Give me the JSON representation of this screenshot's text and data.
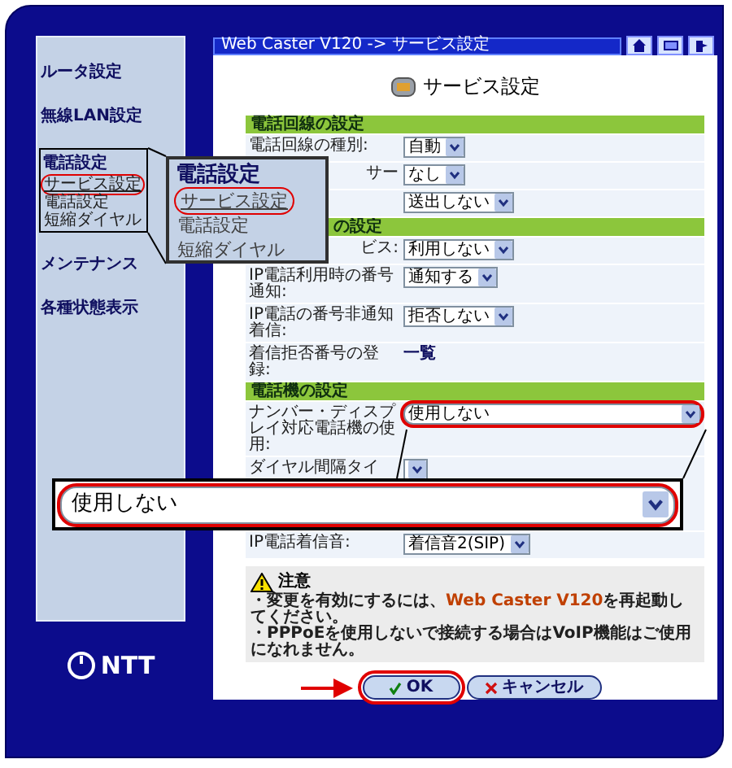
{
  "window": {
    "title": "Web Caster V120 -> サービス設定"
  },
  "sidebar": {
    "items": [
      {
        "label": "ルータ設定"
      },
      {
        "label": "無線LAN設定"
      },
      {
        "label": "電話設定",
        "children": [
          {
            "label": "サービス設定",
            "selected": true
          },
          {
            "label": "電話設定",
            "selected": false
          },
          {
            "label": "短縮ダイヤル",
            "selected": false
          }
        ]
      },
      {
        "label": "メンテナンス"
      },
      {
        "label": "各種状態表示"
      }
    ]
  },
  "sidebar_zoom": {
    "title": "電話設定",
    "items": [
      {
        "label": "サービス設定",
        "selected": true
      },
      {
        "label": "電話設定",
        "selected": false
      },
      {
        "label": "短縮ダイヤル",
        "selected": false
      }
    ]
  },
  "logo": "NTT",
  "page_title": "サービス設定",
  "sections": [
    {
      "title": "電話回線の設定",
      "rows": [
        {
          "label": "電話回線の種別:",
          "kind": "select",
          "value": "自動"
        },
        {
          "label": "サー",
          "kind": "select",
          "value": "なし"
        },
        {
          "kind": "select",
          "value": "送出しない"
        }
      ]
    },
    {
      "title": "の設定",
      "rows": [
        {
          "label": "ビス:",
          "kind": "select",
          "value": "利用しない"
        },
        {
          "label": "IP電話利用時の番号通知:",
          "kind": "select",
          "value": "通知する"
        },
        {
          "label": "IP電話の番号非通知着信:",
          "kind": "select",
          "value": "拒否しない"
        },
        {
          "label": "着信拒否番号の登録:",
          "kind": "link",
          "value": "一覧"
        }
      ]
    },
    {
      "title": "電話機の設定",
      "rows": [
        {
          "label": "ナンバー・ディスプレイ対応電話機の使用:",
          "kind": "select",
          "value": "使用しない",
          "highlighted": true
        },
        {
          "label": "ダイヤル間隔タイ",
          "kind": "select"
        },
        {
          "label": "IP電話着信音:",
          "kind": "select",
          "value": "着信音2(SIP)"
        }
      ]
    }
  ],
  "dropdown_zoom": {
    "value": "使用しない"
  },
  "notice": {
    "title": "注意",
    "lines": [
      "・変更を有効にするには、**Web Caster V120**を再起動してください。",
      "・PPPoEを使用しないで接続する場合はVoIP機能はご使用になれません。"
    ]
  },
  "buttons": [
    {
      "label": "OK",
      "kind": "ok",
      "highlighted": true
    },
    {
      "label": "キャンセル",
      "kind": "cancel",
      "highlighted": false
    }
  ]
}
